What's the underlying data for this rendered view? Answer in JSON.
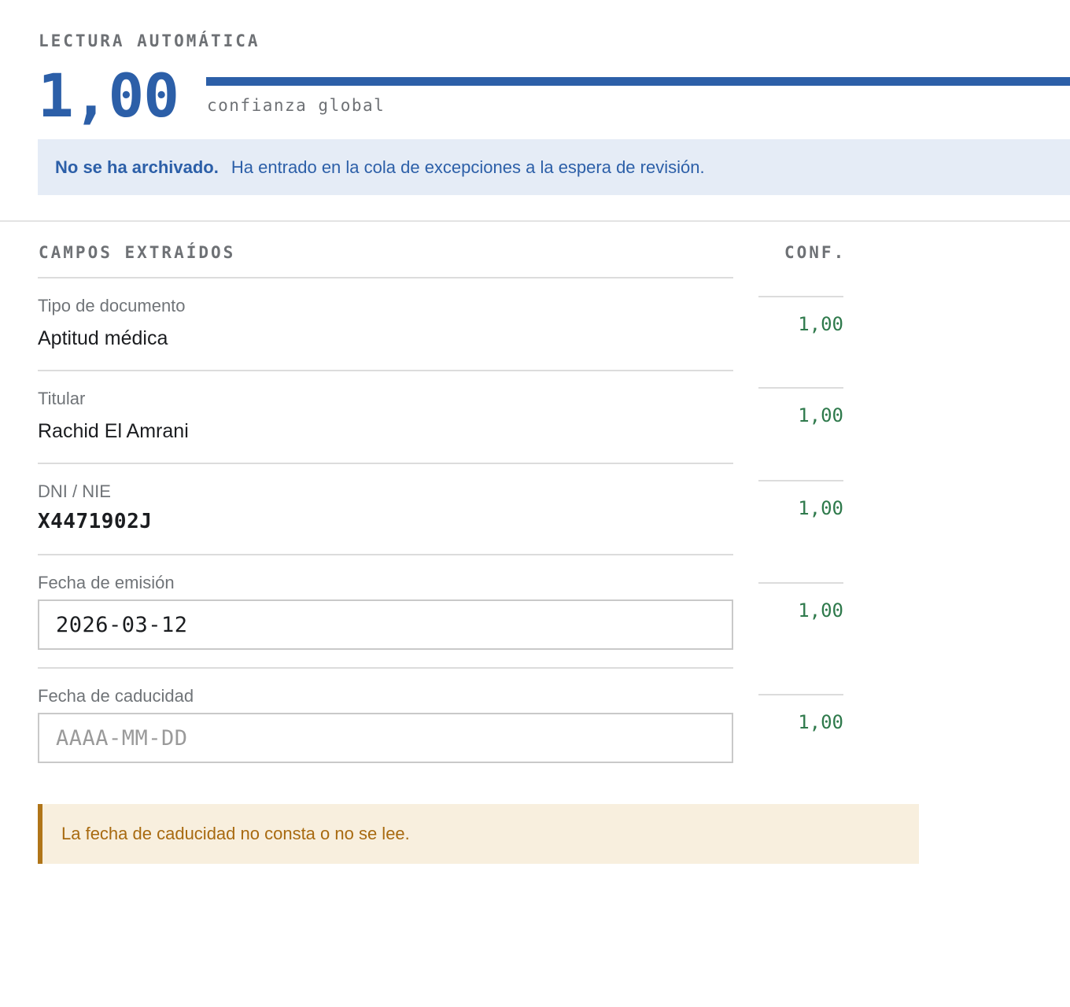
{
  "header": {
    "eyebrow": "LECTURA AUTOMÁTICA",
    "overall_confidence": "1,00",
    "overall_confidence_fraction": 1.0,
    "confidence_caption": "confianza global"
  },
  "notice": {
    "bold": "No se ha archivado.",
    "text": "Ha entrado en la cola de excepciones a la espera de revisión."
  },
  "table": {
    "fields_header": "CAMPOS EXTRAÍDOS",
    "conf_header": "CONF."
  },
  "fields": [
    {
      "label": "Tipo de documento",
      "value": "Aptitud médica",
      "confidence": "1,00"
    },
    {
      "label": "Titular",
      "value": "Rachid El Amrani",
      "confidence": "1,00"
    },
    {
      "label": "DNI / NIE",
      "value": "X4471902J",
      "confidence": "1,00"
    },
    {
      "label": "Fecha de emisión",
      "value": "2026-03-12",
      "confidence": "1,00"
    },
    {
      "label": "Fecha de caducidad",
      "value": "",
      "placeholder": "AAAA-MM-DD",
      "confidence": "1,00"
    }
  ],
  "warning": {
    "text": "La fecha de caducidad no consta o no se lee."
  },
  "colors": {
    "accent": "#2c5fa8",
    "confidence_ok": "#2f7a4c",
    "warning_text": "#a86a10",
    "warning_border": "#b07518",
    "warning_bg": "#f8efde",
    "notice_bg": "#e5ecf6"
  }
}
